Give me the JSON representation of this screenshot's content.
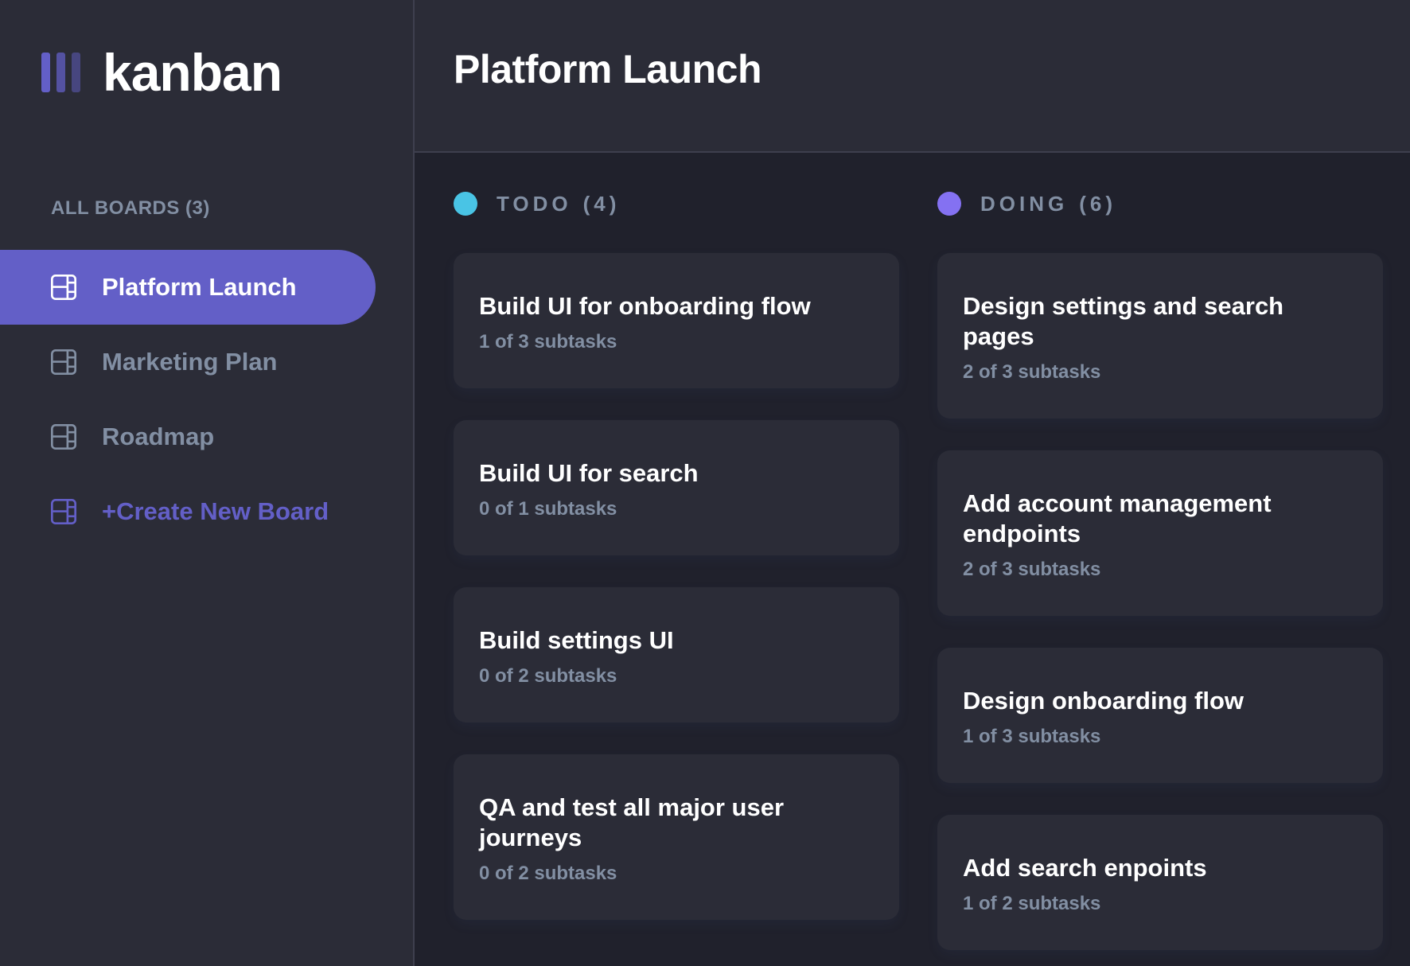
{
  "logo": {
    "text": "kanban"
  },
  "sidebar": {
    "heading": "ALL BOARDS (3)",
    "boards": [
      {
        "label": "Platform Launch",
        "active": true
      },
      {
        "label": "Marketing Plan",
        "active": false
      },
      {
        "label": "Roadmap",
        "active": false
      }
    ],
    "create_label": "+Create New Board"
  },
  "header": {
    "title": "Platform Launch"
  },
  "columns": [
    {
      "name": "TODO",
      "count": "(4)",
      "color": "#49c4e5",
      "cards": [
        {
          "title": "Build UI for onboarding flow",
          "subtasks": "1 of 3 subtasks"
        },
        {
          "title": "Build UI for search",
          "subtasks": "0 of 1 subtasks"
        },
        {
          "title": "Build settings UI",
          "subtasks": "0 of 2 subtasks"
        },
        {
          "title": "QA and test all major user journeys",
          "subtasks": "0 of 2 subtasks"
        }
      ]
    },
    {
      "name": "DOING",
      "count": "(6)",
      "color": "#8471f2",
      "cards": [
        {
          "title": "Design settings and search pages",
          "subtasks": "2 of 3 subtasks"
        },
        {
          "title": "Add account management endpoints",
          "subtasks": "2 of 3 subtasks"
        },
        {
          "title": "Design onboarding flow",
          "subtasks": "1 of 3 subtasks"
        },
        {
          "title": "Add search enpoints",
          "subtasks": "1 of 2 subtasks"
        }
      ]
    }
  ],
  "colors": {
    "accent": "#635fc7",
    "sidebar_bg": "#2b2c37",
    "board_bg": "#20212c",
    "muted_text": "#828fa3"
  }
}
